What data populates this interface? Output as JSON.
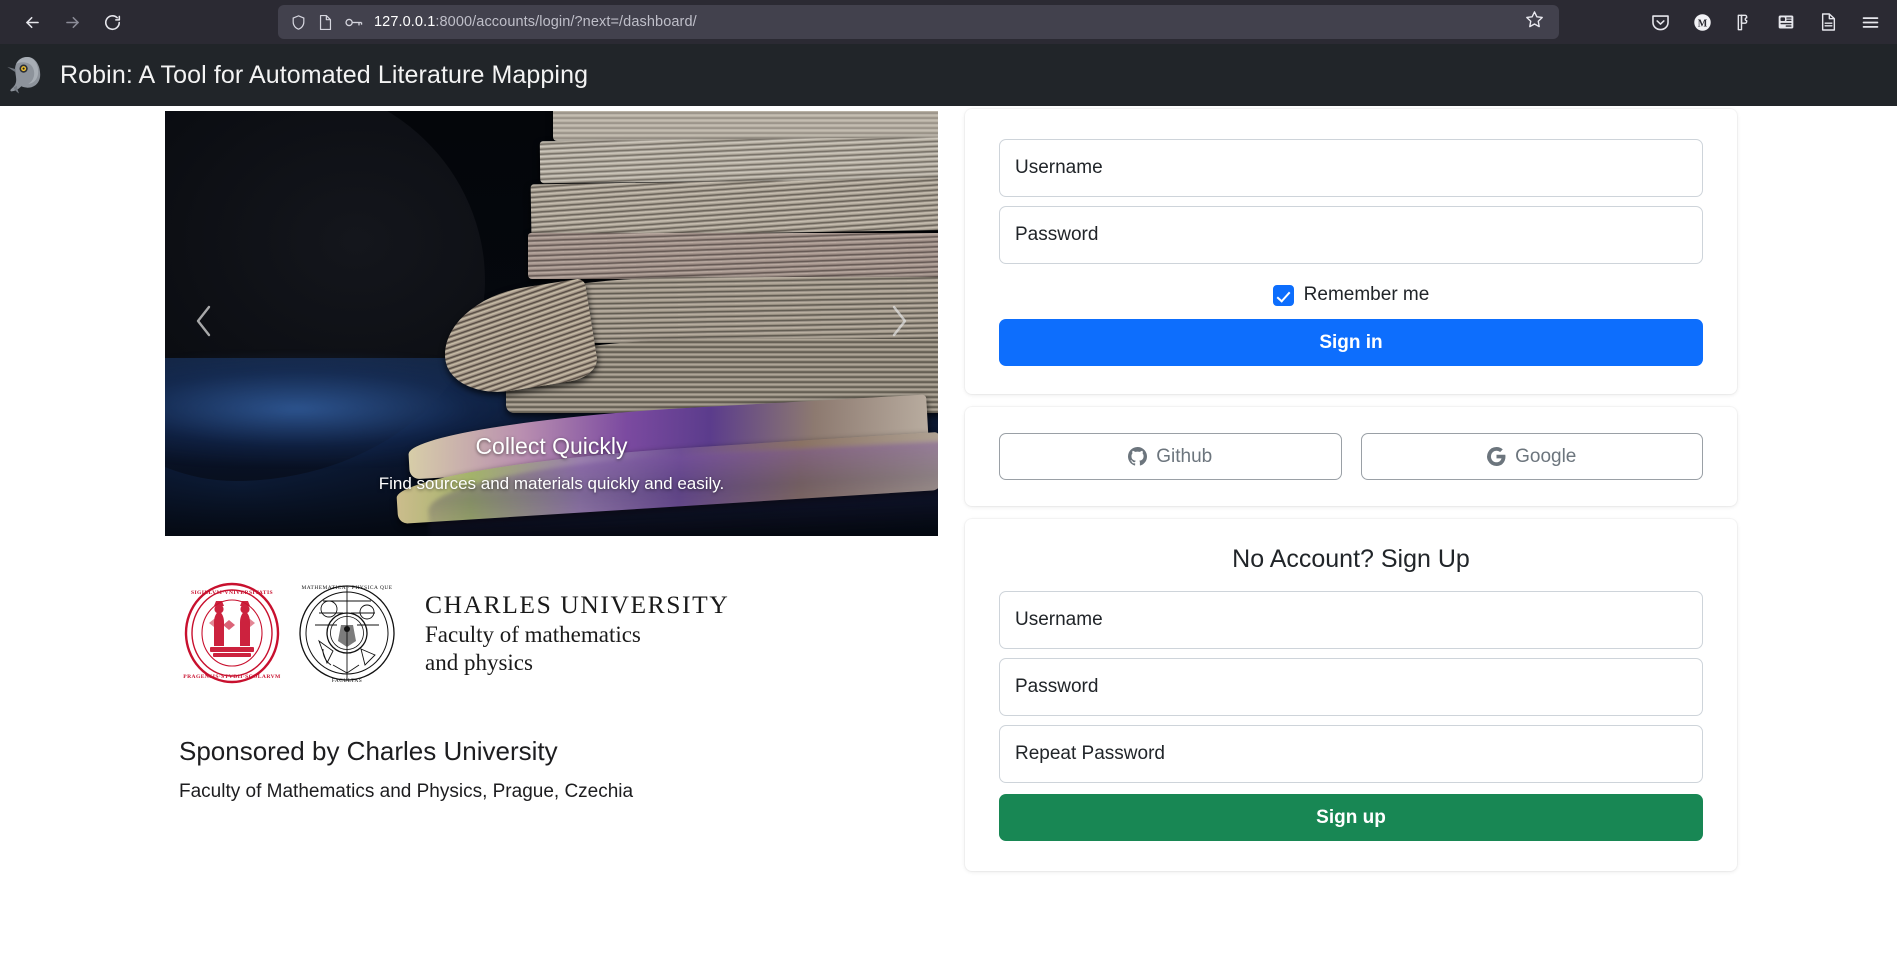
{
  "browser": {
    "back_icon": "back-arrow-icon",
    "forward_icon": "forward-arrow-icon",
    "reload_icon": "reload-icon",
    "shield_icon": "shield-icon",
    "page_icon": "page-info-icon",
    "key_icon": "key-icon",
    "url_host": "127.0.0.1",
    "url_path": ":8000/accounts/login/?next=/dashboard/",
    "bookmark_icon": "star-bookmark-icon",
    "toolbar_icons": [
      "pocket-save-icon",
      "metamask-extension-icon",
      "puzzle-extensions-icon",
      "container-tabs-icon",
      "reader-view-icon",
      "application-menu-icon"
    ]
  },
  "header": {
    "logo_icon": "robin-bird-logo-icon",
    "title": "Robin: A Tool for Automated Literature Mapping"
  },
  "carousel": {
    "prev_icon": "chevron-left-icon",
    "next_icon": "chevron-right-icon",
    "slide_title": "Collect Quickly",
    "slide_text": "Find sources and materials quickly and easily."
  },
  "university": {
    "seal_red_icon": "charles-university-seal-icon",
    "seal_black_icon": "mff-faculty-seal-icon",
    "line1": "CHARLES UNIVERSITY",
    "line2": "Faculty of mathematics",
    "line3": "and physics"
  },
  "sponsor": {
    "title": "Sponsored by Charles University",
    "subtitle": "Faculty of Mathematics and Physics, Prague, Czechia"
  },
  "signin": {
    "username_placeholder": "Username",
    "username_value": "",
    "password_placeholder": "Password",
    "password_value": "",
    "remember_label": "Remember me",
    "remember_checked": "true",
    "submit_label": "Sign in"
  },
  "social": {
    "github_label": "Github",
    "github_icon": "github-icon",
    "google_label": "Google",
    "google_icon": "google-g-icon"
  },
  "signup": {
    "heading": "No Account? Sign Up",
    "username_placeholder": "Username",
    "username_value": "",
    "password_placeholder": "Password",
    "password_value": "",
    "repeat_placeholder": "Repeat Password",
    "repeat_value": "",
    "submit_label": "Sign up"
  },
  "colors": {
    "primary": "#0d6efd",
    "success": "#188754",
    "header_bg": "#212529",
    "chrome_bg": "#2b2a33",
    "urlbar_bg": "#42414d",
    "seal_red": "#c8102e",
    "border": "#ced4da"
  }
}
